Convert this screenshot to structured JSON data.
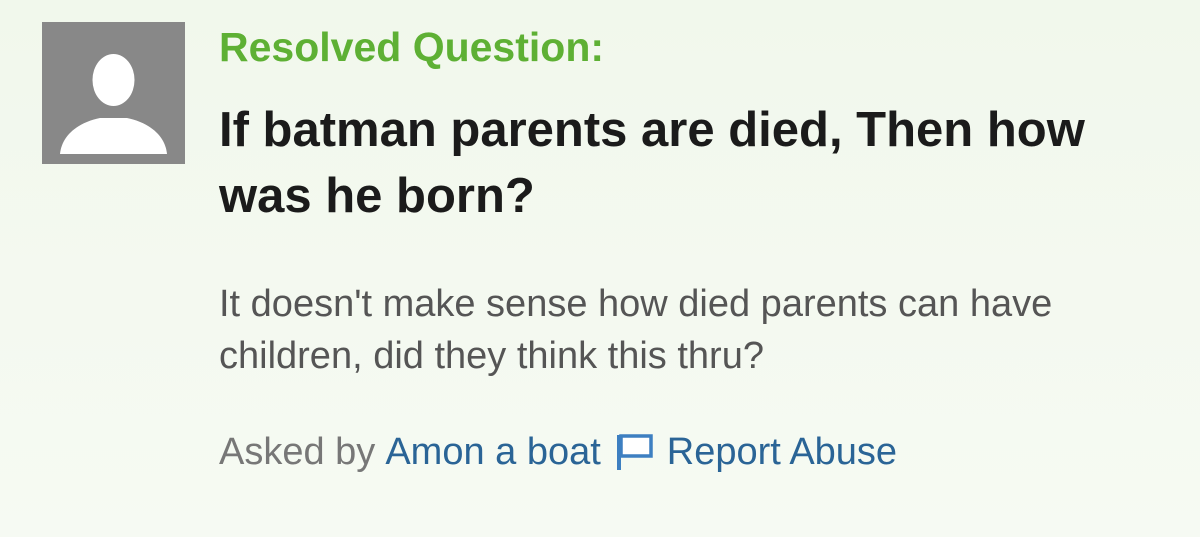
{
  "question": {
    "status": "Resolved Question:",
    "title": "If batman parents are died, Then how was he born?",
    "body": "It doesn't make sense how died parents can have children, did they think this thru?",
    "asked_by_label": "Asked by",
    "author": "Amon a boat",
    "report_label": "Report Abuse"
  },
  "icons": {
    "avatar": "user-silhouette-icon",
    "report": "flag-icon"
  },
  "colors": {
    "status": "#5eb034",
    "link": "#2a6496",
    "avatar_bg": "#888888"
  }
}
